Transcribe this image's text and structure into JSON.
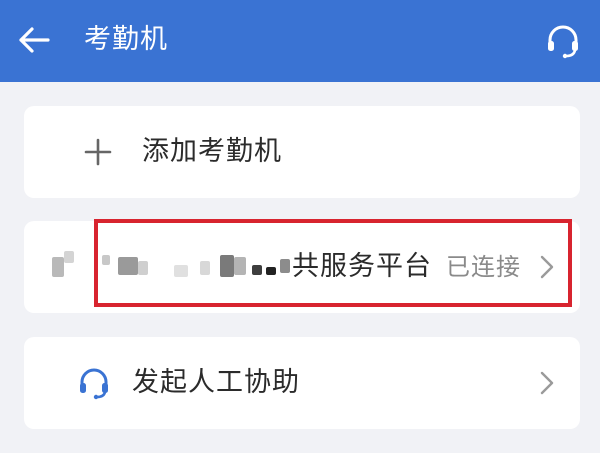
{
  "header": {
    "title": "考勤机",
    "back_icon": "arrow-left-icon",
    "support_icon": "headset-icon",
    "background_color": "#3a73d3"
  },
  "add_device": {
    "icon": "plus-icon",
    "label": "添加考勤机"
  },
  "device": {
    "name_visible": "共服务平台",
    "status": "已连接",
    "chevron_icon": "chevron-right-icon",
    "highlight_color": "#d8242f"
  },
  "assist": {
    "icon": "headset-icon",
    "label": "发起人工协助",
    "chevron_icon": "chevron-right-icon"
  }
}
